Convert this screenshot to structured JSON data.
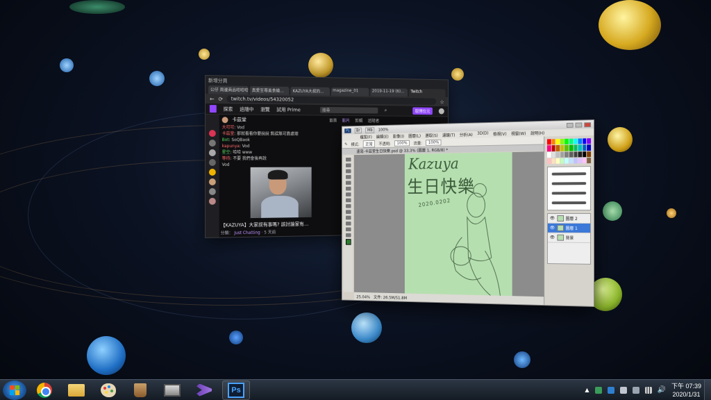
{
  "browser": {
    "title": "新增分頁",
    "tabs": [
      "公仔 周邊商品哈哈哈",
      "真愛至尊美食繪…",
      "KAZUYA大叔的…",
      "magazine_01",
      "2019-11-19 (6)…",
      "Twitch"
    ],
    "url": "twitch.tv/videos/54320052",
    "nav": [
      "探索",
      "追隨中",
      "瀏覽",
      "試用 Prime"
    ],
    "search_placeholder": "搜尋",
    "get_button": "取得位元",
    "channel_name": "卡茲堂",
    "channel_tabs": [
      "首頁",
      "影片",
      "剪輯",
      "追隨者"
    ],
    "chat_lines": [
      {
        "user": "大可可",
        "text": "Vod"
      },
      {
        "user": "卡茲堂",
        "text": "那就看看你要說說 無誤無可靠處理"
      },
      {
        "user": "Bot",
        "text": "SoQBaok"
      },
      {
        "user": "kapunya",
        "text": "Vod"
      },
      {
        "user": "星空",
        "text": "哈哈 www"
      },
      {
        "user": "等待",
        "text": "不要 我們會後再說"
      },
      {
        "user": "",
        "text": "Vod"
      }
    ],
    "stream_title": "【KAZUYA】大家叔有事嗎? 該討論家有…",
    "stream_views": "5 天前",
    "stream_meta_label": "分類：",
    "stream_category": "Just Chatting"
  },
  "photoshop": {
    "menu": [
      "檔案(F)",
      "編輯(E)",
      "影像(I)",
      "圖層(L)",
      "選取(S)",
      "濾鏡(T)",
      "分析(A)",
      "3D(D)",
      "檢視(V)",
      "視窗(W)",
      "說明(H)"
    ],
    "window_buttons": [
      "Br",
      "Mb"
    ],
    "zoom": "100%",
    "options": {
      "mode_label": "模式:",
      "mode_value": "正常",
      "opacity_label": "不透明:",
      "opacity_value": "100%",
      "flow_label": "流量:",
      "flow_value": "100%"
    },
    "doc_tab": "速寫-卡茲堂生日快樂.psd @ 33.3% (圖層 1, RGB/8) *",
    "canvas_text": {
      "line1": "Kazuya",
      "line2": "生日快樂",
      "date": "2020.0202"
    },
    "status": {
      "zoom": "25.04%",
      "doc": "文件: 26.5M/51.8M"
    },
    "layers": [
      "圖層 2",
      "圖層 1",
      "背景"
    ],
    "swatch_colors": [
      "#ff0000",
      "#ff8000",
      "#ffff00",
      "#80ff00",
      "#00ff00",
      "#00ff80",
      "#00ffff",
      "#0080ff",
      "#0000ff",
      "#8000ff",
      "#ff0080",
      "#c00000",
      "#c06000",
      "#c0c000",
      "#60c000",
      "#00c000",
      "#00c060",
      "#00c0c0",
      "#0060c0",
      "#0000c0",
      "#ffffff",
      "#e0e0e0",
      "#c0c0c0",
      "#a0a0a0",
      "#808080",
      "#606060",
      "#404040",
      "#202020",
      "#000000",
      "#804000",
      "#ffc0c0",
      "#ffe0c0",
      "#ffffc0",
      "#c0ffc0",
      "#c0ffff",
      "#c0e0ff",
      "#c0c0ff",
      "#e0c0ff",
      "#ffc0ff",
      "#806040"
    ]
  },
  "taskbar": {
    "apps": [
      "start-button",
      "chrome-icon",
      "explorer-icon",
      "paint-icon",
      "brush-icon",
      "film-icon",
      "visual-studio-icon",
      "photoshop-icon"
    ],
    "photoshop_label": "Ps",
    "clock": {
      "time": "下午 07:39",
      "date": "2020/1/31"
    }
  }
}
